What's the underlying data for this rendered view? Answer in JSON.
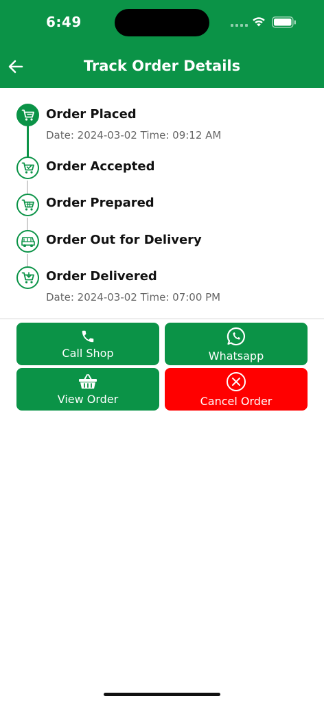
{
  "status_bar": {
    "time": "6:49"
  },
  "header": {
    "title": "Track Order Details",
    "back_icon": "arrow-left-icon"
  },
  "timeline": {
    "steps": [
      {
        "title": "Order Placed",
        "date": "Date: 2024-03-02 Time: 09:12 AM",
        "icon": "cart-icon",
        "completed": true
      },
      {
        "title": "Order Accepted",
        "icon": "cart-check-icon",
        "completed": false
      },
      {
        "title": "Order Prepared",
        "icon": "cart-icon",
        "completed": false
      },
      {
        "title": "Order Out for Delivery",
        "icon": "delivery-cart-icon",
        "completed": false
      },
      {
        "title": "Order Delivered",
        "date": "Date: 2024-03-02 Time: 07:00 PM",
        "icon": "cart-delivered-icon",
        "completed": false
      }
    ]
  },
  "actions": {
    "call_shop": {
      "label": "Call Shop",
      "icon": "phone-icon"
    },
    "whatsapp": {
      "label": "Whatsapp",
      "icon": "whatsapp-icon"
    },
    "view_order": {
      "label": "View Order",
      "icon": "basket-icon"
    },
    "cancel_order": {
      "label": "Cancel Order",
      "icon": "close-circle-icon"
    }
  },
  "colors": {
    "brand": "#0b9347",
    "danger": "#ff0000",
    "pending_line": "#cfcfcf"
  }
}
